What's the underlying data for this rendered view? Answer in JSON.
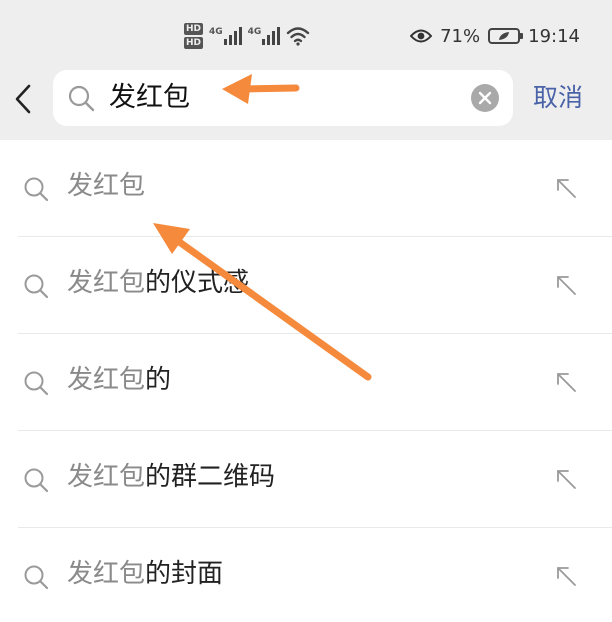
{
  "status_bar": {
    "hd1": "HD",
    "hd2": "HD",
    "sig1_label": "4G",
    "sig2_label": "4G",
    "battery_percent": "71%",
    "time": "19:14",
    "icons": [
      "hd-volte-icon",
      "signal-icon",
      "wifi-icon",
      "eye-comfort-icon",
      "battery-icon"
    ]
  },
  "search": {
    "query": "发红包",
    "cancel_label": "取消"
  },
  "suggestions": [
    {
      "highlight": "发红包",
      "rest": ""
    },
    {
      "highlight": "发红包",
      "rest": "的仪式感"
    },
    {
      "highlight": "发红包",
      "rest": "的"
    },
    {
      "highlight": "发红包",
      "rest": "的群二维码"
    },
    {
      "highlight": "发红包",
      "rest": "的封面"
    }
  ],
  "colors": {
    "header_bg": "#eeeeee",
    "cancel": "#4a63a8",
    "annotation_arrow": "#f58a3c",
    "match_text": "#8a8a8a"
  }
}
